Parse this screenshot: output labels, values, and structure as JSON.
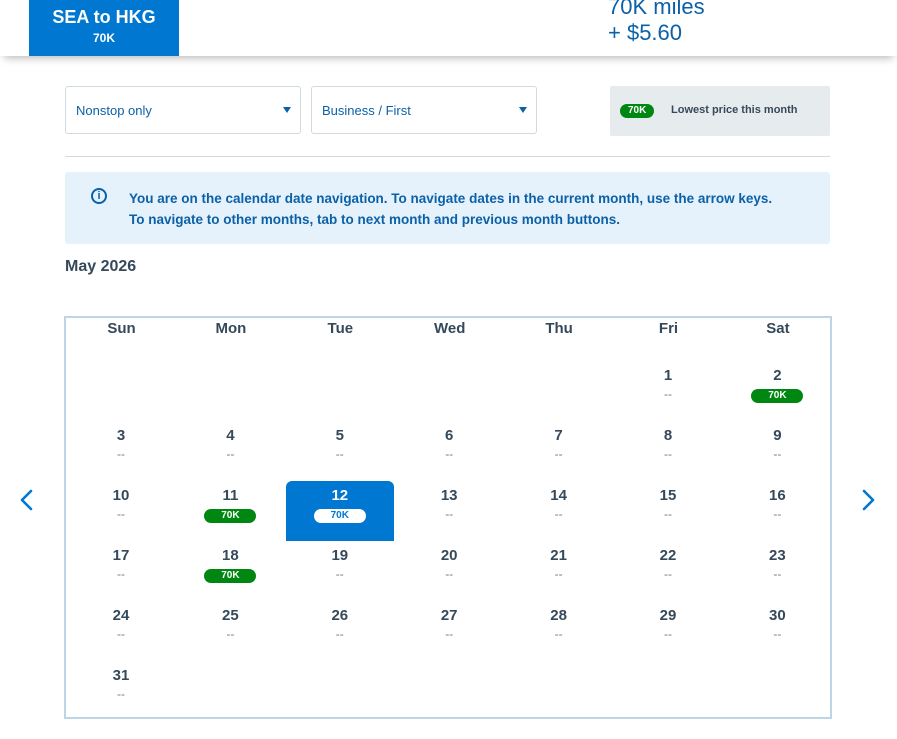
{
  "header": {
    "route": "SEA to HKG",
    "route_price": "70K",
    "award_miles": "70K miles",
    "award_fee": "+ $5.60"
  },
  "filters": {
    "stops": "Nonstop only",
    "cabin": "Business / First"
  },
  "legend": {
    "badge": "70K",
    "text": "Lowest price this month"
  },
  "info": {
    "message": "You are on the calendar date navigation. To navigate dates in the current month, use the arrow keys. To navigate to other months, tab to next month and previous month buttons."
  },
  "calendar": {
    "month": "May 2026",
    "weekdays": [
      "Sun",
      "Mon",
      "Tue",
      "Wed",
      "Thu",
      "Fri",
      "Sat"
    ],
    "first_weekday_index": 5,
    "selected_day": 12,
    "days": [
      {
        "day": "1",
        "price": "--"
      },
      {
        "day": "2",
        "price": "70K"
      },
      {
        "day": "3",
        "price": "--"
      },
      {
        "day": "4",
        "price": "--"
      },
      {
        "day": "5",
        "price": "--"
      },
      {
        "day": "6",
        "price": "--"
      },
      {
        "day": "7",
        "price": "--"
      },
      {
        "day": "8",
        "price": "--"
      },
      {
        "day": "9",
        "price": "--"
      },
      {
        "day": "10",
        "price": "--"
      },
      {
        "day": "11",
        "price": "70K"
      },
      {
        "day": "12",
        "price": "70K"
      },
      {
        "day": "13",
        "price": "--"
      },
      {
        "day": "14",
        "price": "--"
      },
      {
        "day": "15",
        "price": "--"
      },
      {
        "day": "16",
        "price": "--"
      },
      {
        "day": "17",
        "price": "--"
      },
      {
        "day": "18",
        "price": "70K"
      },
      {
        "day": "19",
        "price": "--"
      },
      {
        "day": "20",
        "price": "--"
      },
      {
        "day": "21",
        "price": "--"
      },
      {
        "day": "22",
        "price": "--"
      },
      {
        "day": "23",
        "price": "--"
      },
      {
        "day": "24",
        "price": "--"
      },
      {
        "day": "25",
        "price": "--"
      },
      {
        "day": "26",
        "price": "--"
      },
      {
        "day": "27",
        "price": "--"
      },
      {
        "day": "28",
        "price": "--"
      },
      {
        "day": "29",
        "price": "--"
      },
      {
        "day": "30",
        "price": "--"
      },
      {
        "day": "31",
        "price": "--"
      }
    ]
  },
  "colors": {
    "brand_blue": "#0078d2",
    "text_blue": "#0b61a8",
    "lowest_price_green": "#008712"
  },
  "icons": {
    "info": "info-circle-icon",
    "prev": "chevron-left-icon",
    "next": "chevron-right-icon"
  }
}
